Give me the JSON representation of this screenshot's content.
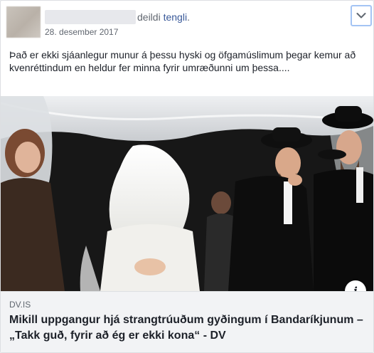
{
  "post": {
    "shared_label": "deildi",
    "shared_link": "tengli",
    "shared_suffix": ".",
    "date": "28. desember 2017",
    "text": "Það er ekki sjáanlegur munur á þessu hyski og öfgamúslimum þegar kemur að kvenréttindum en heldur fer minna fyrir umræðunni um þessa....",
    "menu_icon": "chevron-down-icon"
  },
  "link_preview": {
    "domain": "DV.IS",
    "headline": "Mikill uppgangur hjá strangtrúuðum gyðingum í Bandaríkjunum – „Takk guð, fyrir að ég er ekki kona“ - DV",
    "info_icon_label": "i"
  },
  "colors": {
    "link": "#385898",
    "meta": "#616770",
    "text": "#1d2129",
    "preview_bg": "#f2f3f5"
  }
}
